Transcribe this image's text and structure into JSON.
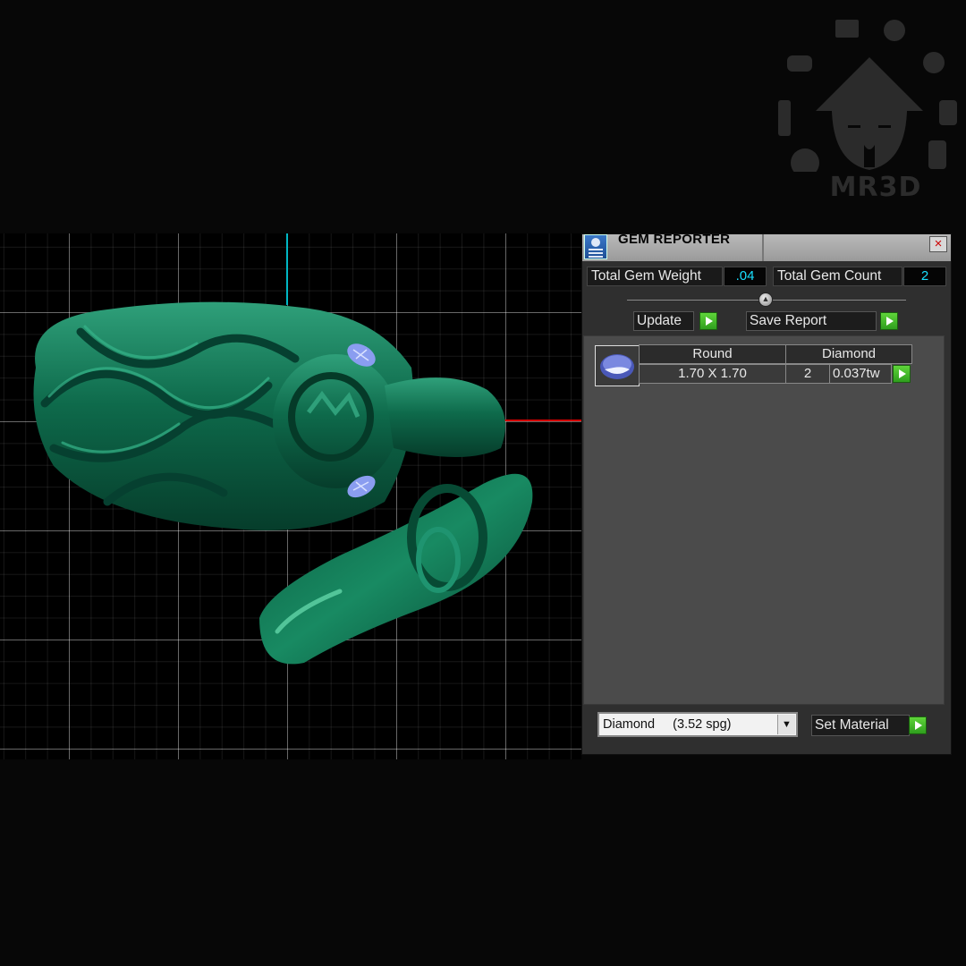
{
  "watermark": {
    "brand": "MR3D"
  },
  "panel": {
    "title": "GEM REPORTER",
    "close_symbol": "×",
    "total_weight_label": "Total Gem Weight",
    "total_weight_value": ".04",
    "total_count_label": "Total Gem Count",
    "total_count_value": "2",
    "update_label": "Update",
    "save_report_label": "Save Report",
    "table": {
      "headers": [
        "Round",
        "Diamond"
      ],
      "row": {
        "size": "1.70 X 1.70",
        "count": "2",
        "weight": "0.037tw"
      }
    },
    "material_selected": "Diamond     (3.52 spg)",
    "set_material_label": "Set Material"
  },
  "colors": {
    "model": "#0f6e4e",
    "accent_value": "#19e0ff",
    "play_green": "#3fba24",
    "axis_x": "#d40000",
    "axis_y": "#00b7c4"
  },
  "icons": {
    "title": "gem-reporter-app-icon",
    "close": "close-icon",
    "play": "play-arrow-icon",
    "dropdown": "chevron-down-icon",
    "gem": "round-gem-icon"
  }
}
